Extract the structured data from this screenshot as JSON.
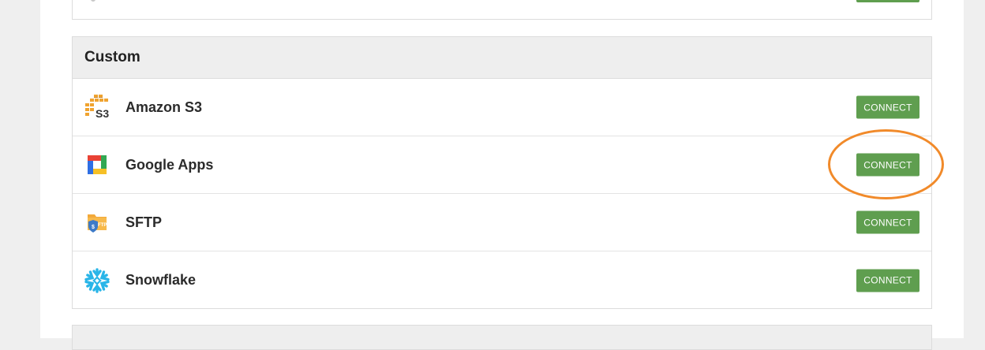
{
  "section": {
    "title": "Custom"
  },
  "integrations": [
    {
      "name": "Amazon S3",
      "icon": "amazon-s3-icon",
      "button_label": "CONNECT"
    },
    {
      "name": "Google Apps",
      "icon": "google-apps-icon",
      "button_label": "CONNECT"
    },
    {
      "name": "SFTP",
      "icon": "sftp-icon",
      "button_label": "CONNECT"
    },
    {
      "name": "Snowflake",
      "icon": "snowflake-icon",
      "button_label": "CONNECT"
    }
  ],
  "colors": {
    "connect_button": "#5f9e4f",
    "highlight": "#f18a2a",
    "section_header_bg": "#eeeeee",
    "page_bg": "#efefef"
  }
}
